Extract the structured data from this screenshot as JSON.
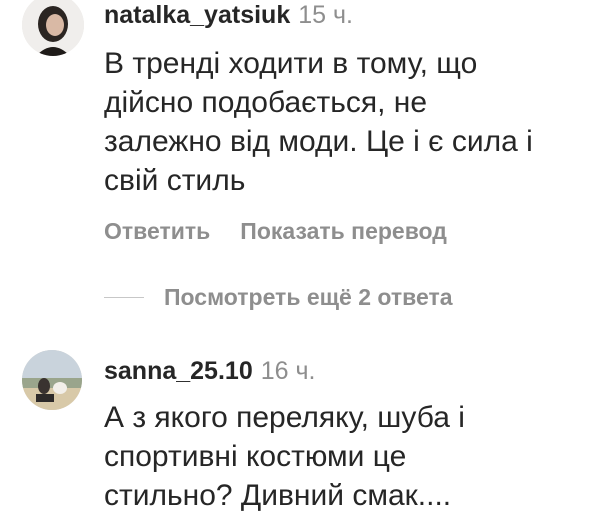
{
  "comments": [
    {
      "username": "natalka_yatsiuk",
      "time": "15 ч.",
      "lines": [
        "В тренді ходити в тому, що",
        "дійсно подобається, не",
        "залежно від моди. Це і є сила і",
        "свій стиль"
      ],
      "reply_label": "Ответить",
      "translate_label": "Показать перевод",
      "avatar_icon": "user-avatar-photo"
    },
    {
      "username": "sanna_25.10",
      "time": "16 ч.",
      "lines": [
        "А з якого переляку, шуба і",
        "спортивні костюми це",
        "стильно? Дивний смак...."
      ],
      "avatar_icon": "user-avatar-photo"
    }
  ],
  "view_more_replies": "Посмотреть ещё 2 ответа",
  "colors": {
    "text": "#262626",
    "secondary": "#8e8e8e",
    "divider": "#c7c7c7",
    "background": "#ffffff"
  }
}
